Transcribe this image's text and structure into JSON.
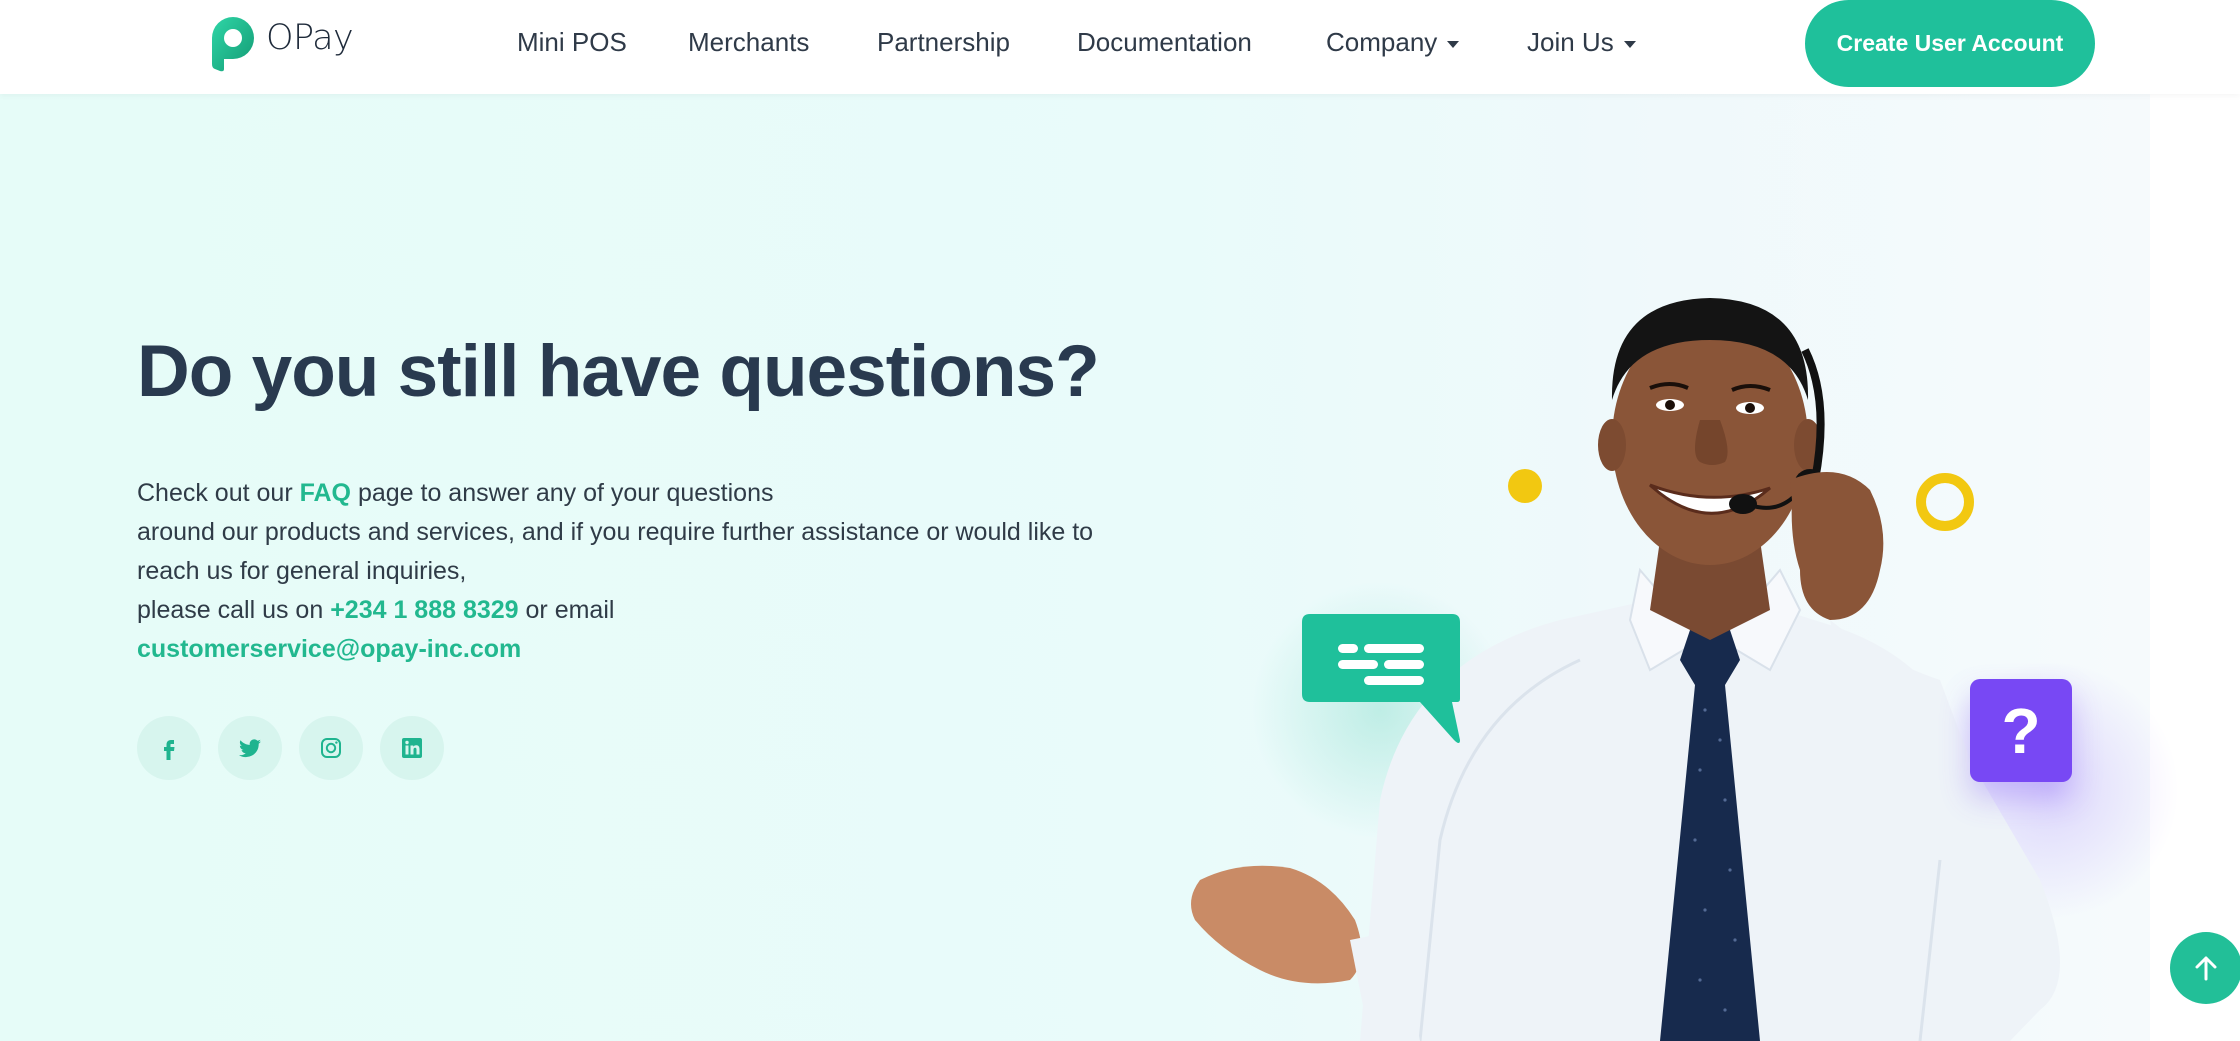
{
  "brand": {
    "name": "OPay",
    "accent_color": "#1fc09b",
    "link_color": "#22b88f"
  },
  "nav": {
    "items": [
      {
        "label": "Mini POS",
        "has_dropdown": false
      },
      {
        "label": "Merchants",
        "has_dropdown": false
      },
      {
        "label": "Partnership",
        "has_dropdown": false
      },
      {
        "label": "Documentation",
        "has_dropdown": false
      },
      {
        "label": "Company",
        "has_dropdown": true
      },
      {
        "label": "Join Us",
        "has_dropdown": true
      }
    ],
    "cta_label": "Create User Account"
  },
  "hero": {
    "title": "Do you still have questions?",
    "line1_before": "Check out our ",
    "faq_link": "FAQ",
    "line1_after": " page to answer any of your questions",
    "line2": "around our products and services, and if you require further assistance or would like to",
    "line3": "reach us for general inquiries,",
    "line4_before": "please call us on ",
    "phone": "+234 1 888 8329",
    "line4_after": " or email",
    "email": "customerservice@opay-inc.com"
  },
  "socials": [
    {
      "name": "facebook",
      "icon": "facebook-icon"
    },
    {
      "name": "twitter",
      "icon": "twitter-icon"
    },
    {
      "name": "instagram",
      "icon": "instagram-icon"
    },
    {
      "name": "linkedin",
      "icon": "linkedin-icon"
    }
  ],
  "illustration": {
    "description": "Smiling customer service agent with headset",
    "question_mark": "?"
  },
  "scroll_top": {
    "icon": "arrow-up-icon"
  }
}
